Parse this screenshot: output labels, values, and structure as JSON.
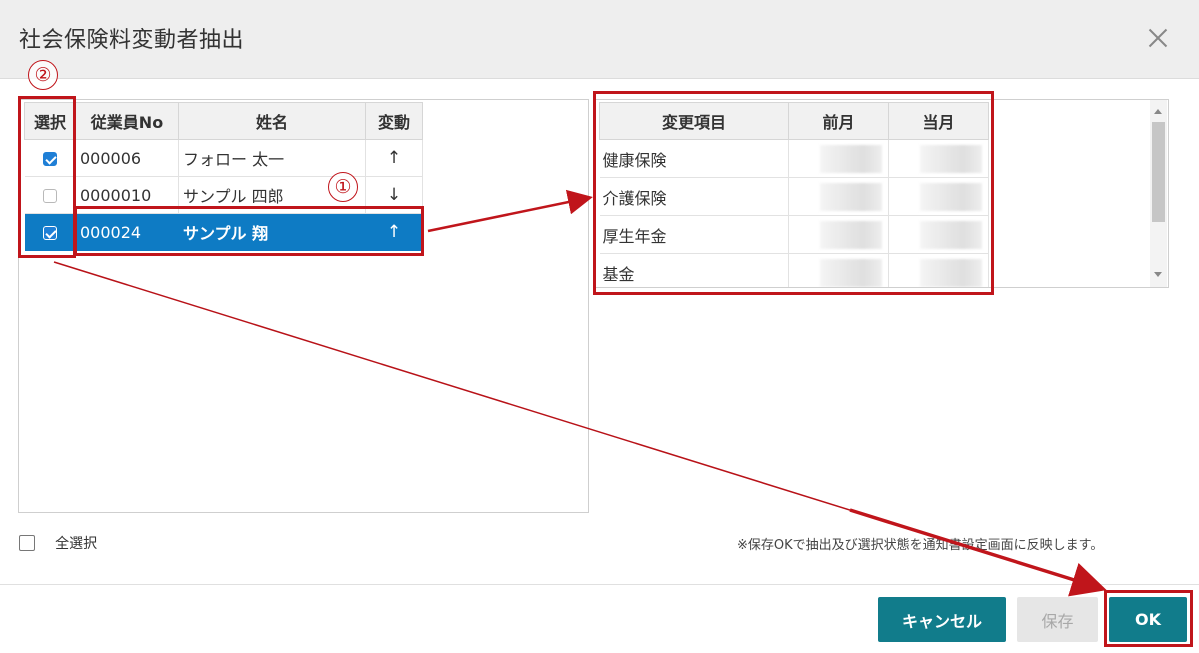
{
  "dialog": {
    "title": "社会保険料変動者抽出",
    "close_icon": "close-icon"
  },
  "employee_table": {
    "headers": [
      "選択",
      "従業員No",
      "姓名",
      "変動"
    ],
    "rows": [
      {
        "checked": true,
        "emp_no": "000006",
        "name": "フォロー 太一",
        "change": "↑",
        "direction": "up",
        "selected": false
      },
      {
        "checked": false,
        "emp_no": "0000010",
        "name": "サンプル 四郎",
        "change": "↓",
        "direction": "down",
        "selected": false
      },
      {
        "checked": true,
        "emp_no": "000024",
        "name": "サンプル 翔",
        "change": "↑",
        "direction": "up",
        "selected": true
      }
    ]
  },
  "detail_table": {
    "headers": [
      "変更項目",
      "前月",
      "当月"
    ],
    "rows": [
      {
        "item": "健康保険"
      },
      {
        "item": "介護保険"
      },
      {
        "item": "厚生年金"
      },
      {
        "item": "基金"
      }
    ]
  },
  "select_all": {
    "label": "全選択",
    "checked": false
  },
  "note": "※保存OKで抽出及び選択状態を通知書設定画面に反映します。",
  "buttons": {
    "cancel": "キャンセル",
    "save": "保存",
    "ok": "OK"
  },
  "annotations": {
    "marker_1": "①",
    "marker_2": "②",
    "color": "#c0151b"
  },
  "colors": {
    "selected_row": "#0e7bc4",
    "primary_button": "#117c8b",
    "checkbox_on": "#1f7fd6",
    "up_arrow": "#1a3fa8",
    "down_arrow": "#d0342c"
  }
}
